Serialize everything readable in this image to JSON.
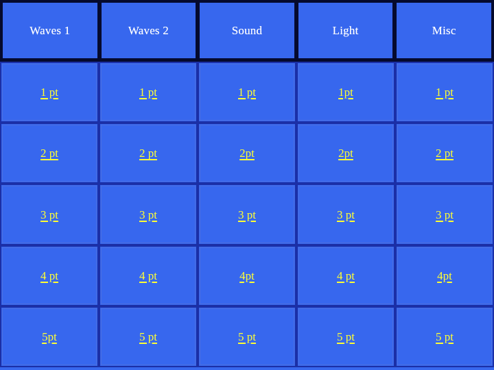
{
  "board": {
    "title": "Jeopardy Category Board",
    "accent_cell_color": "#3767ee",
    "border_color": "#1b2fa6",
    "header_gap_color": "#050a2e",
    "header_text_color": "#ffffff",
    "value_text_color": "#ffff33"
  },
  "categories": [
    {
      "label": "Waves 1"
    },
    {
      "label": "Waves 2"
    },
    {
      "label": "Sound"
    },
    {
      "label": "Light"
    },
    {
      "label": "Misc"
    }
  ],
  "rows": [
    {
      "cells": [
        "1 pt",
        "1 pt",
        "1 pt",
        "1pt",
        "1 pt"
      ]
    },
    {
      "cells": [
        "2 pt",
        "2 pt",
        "2pt",
        "2pt",
        "2 pt"
      ]
    },
    {
      "cells": [
        "3 pt",
        "3 pt",
        "3 pt",
        "3 pt",
        "3 pt"
      ]
    },
    {
      "cells": [
        "4 pt",
        "4 pt",
        "4pt",
        "4 pt",
        "4pt"
      ]
    },
    {
      "cells": [
        "5pt",
        "5 pt",
        "5 pt",
        "5 pt",
        "5 pt"
      ]
    }
  ]
}
